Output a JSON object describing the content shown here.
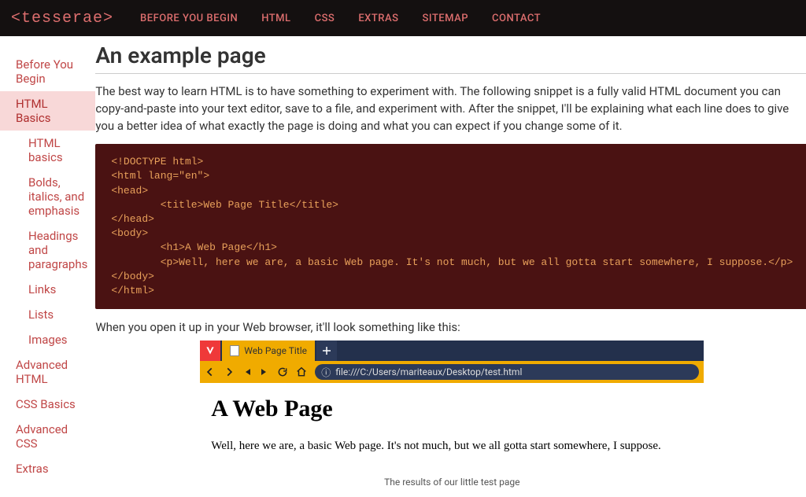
{
  "header": {
    "logo": "<tesserae>",
    "nav": [
      "BEFORE YOU BEGIN",
      "HTML",
      "CSS",
      "EXTRAS",
      "SITEMAP",
      "CONTACT"
    ]
  },
  "sidebar": {
    "items": [
      {
        "label": "Before You Begin",
        "active": false,
        "sub": []
      },
      {
        "label": "HTML Basics",
        "active": true,
        "sub": [
          "HTML basics",
          "Bolds, italics, and emphasis",
          "Headings and paragraphs",
          "Links",
          "Lists",
          "Images"
        ]
      },
      {
        "label": "Advanced HTML",
        "active": false,
        "sub": []
      },
      {
        "label": "CSS Basics",
        "active": false,
        "sub": []
      },
      {
        "label": "Advanced CSS",
        "active": false,
        "sub": []
      },
      {
        "label": "Extras",
        "active": false,
        "sub": []
      }
    ]
  },
  "article": {
    "title": "An example page",
    "intro": "The best way to learn HTML is to have something to experiment with. The following snippet is a fully valid HTML document you can copy-and-paste into your text editor, save to a file, and experiment with. After the snippet, I'll be explaining what each line does to give you a better idea of what exactly the page is doing and what you can expect if you change some of it.",
    "code": "<!DOCTYPE html>\n<html lang=\"en\">\n<head>\n        <title>Web Page Title</title>\n</head>\n<body>\n        <h1>A Web Page</h1>\n        <p>Well, here we are, a basic Web page. It's not much, but we all gotta start somewhere, I suppose.</p>\n</body>\n</html>",
    "after": "When you open it up in your Web browser, it'll look something like this:",
    "caption": "The results of our little test page"
  },
  "browser": {
    "tab_title": "Web Page Title",
    "url": "file:///C:/Users/mariteaux/Desktop/test.html",
    "page_h1": "A Web Page",
    "page_p": "Well, here we are, a basic Web page. It's not much, but we all gotta start somewhere, I suppose."
  }
}
